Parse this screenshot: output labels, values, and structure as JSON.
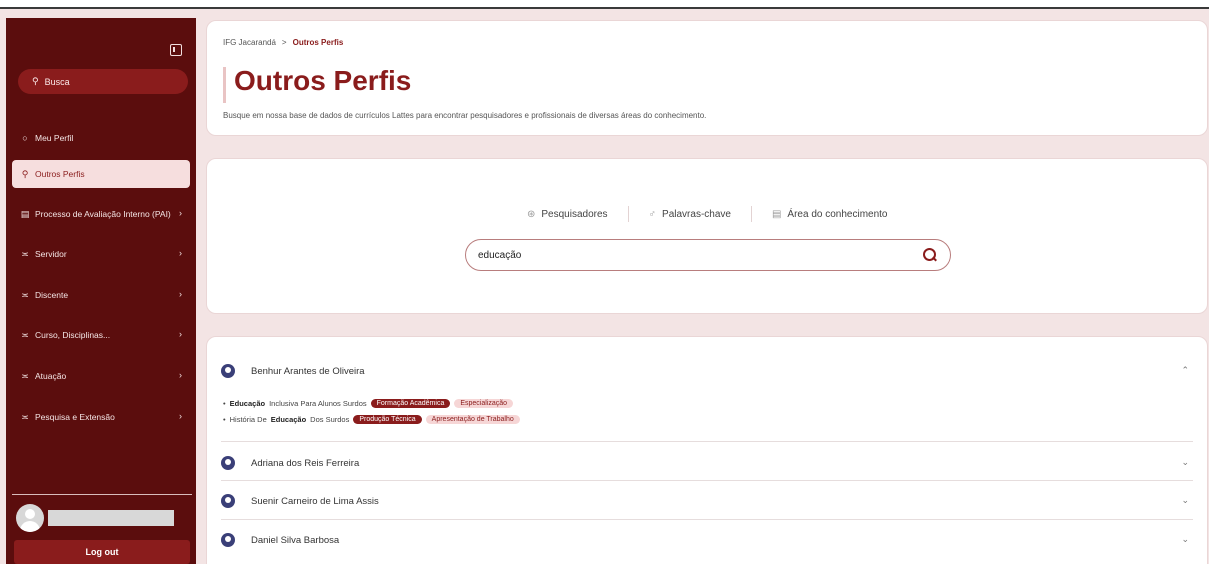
{
  "sidebar": {
    "search_label": "Busca",
    "items": [
      {
        "label": "Meu Perfil",
        "icon": "user-icon",
        "active": false,
        "has_chevron": false
      },
      {
        "label": "Outros Perfis",
        "icon": "search-user-icon",
        "active": true,
        "has_chevron": false
      },
      {
        "label": "Processo de Avaliação Interno (PAI)",
        "icon": "book-icon",
        "active": false,
        "has_chevron": true
      },
      {
        "label": "Servidor",
        "icon": "sliders-icon",
        "active": false,
        "has_chevron": true
      },
      {
        "label": "Discente",
        "icon": "sliders-icon",
        "active": false,
        "has_chevron": true
      },
      {
        "label": "Curso, Disciplinas...",
        "icon": "sliders-icon",
        "active": false,
        "has_chevron": true
      },
      {
        "label": "Atuação",
        "icon": "sliders-icon",
        "active": false,
        "has_chevron": true
      },
      {
        "label": "Pesquisa e Extensão",
        "icon": "sliders-icon",
        "active": false,
        "has_chevron": true
      }
    ],
    "logout_label": "Log out"
  },
  "header": {
    "breadcrumb_root": "IFG Jacarandá",
    "breadcrumb_sep": ">",
    "breadcrumb_current": "Outros Perfis",
    "title": "Outros Perfis",
    "description": "Busque em nossa base de dados de currículos Lattes para encontrar pesquisadores e profissionais de diversas áreas do conhecimento."
  },
  "search": {
    "tabs": [
      {
        "label": "Pesquisadores",
        "icon": "people-icon"
      },
      {
        "label": "Palavras-chave",
        "icon": "key-icon"
      },
      {
        "label": "Área do conhecimento",
        "icon": "document-icon"
      }
    ],
    "query": "educação"
  },
  "results": [
    {
      "name": "Benhur Arantes de Oliveira",
      "expanded": true,
      "hits": [
        {
          "bold": "Educação",
          "rest": "Inclusiva Para Alunos Surdos",
          "badge_primary": "Formação Acadêmica",
          "badge_secondary": "Especialização"
        },
        {
          "prefix": "História De",
          "bold": "Educação",
          "rest": "Dos Surdos",
          "badge_primary": "Produção Técnica",
          "badge_secondary": "Apresentação de Trabalho"
        }
      ]
    },
    {
      "name": "Adriana dos Reis Ferreira",
      "expanded": false
    },
    {
      "name": "Suenir Carneiro de Lima Assis",
      "expanded": false
    },
    {
      "name": "Daniel Silva Barbosa",
      "expanded": false
    }
  ],
  "colors": {
    "primary": "#8a1c1c",
    "sidebar_bg": "#5b0d0d",
    "page_bg": "#f3e4e4"
  }
}
